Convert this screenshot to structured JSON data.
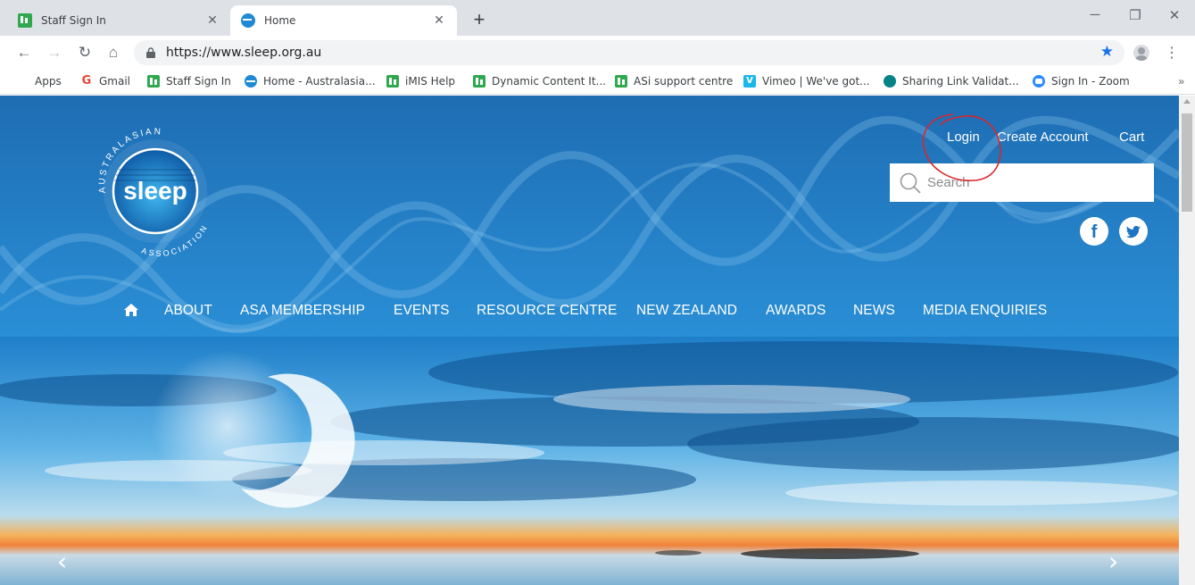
{
  "browser": {
    "tabs": [
      {
        "title": "Staff Sign In",
        "icon": "imis-icon",
        "active": false
      },
      {
        "title": "Home",
        "icon": "site-favicon",
        "active": true
      }
    ],
    "new_tab": "+",
    "url": "https://www.sleep.org.au",
    "bookmarks": [
      {
        "label": "Apps",
        "icon": "apps-grid-icon"
      },
      {
        "label": "Gmail",
        "icon": "gmail-icon"
      },
      {
        "label": "Staff Sign In",
        "icon": "imis-icon"
      },
      {
        "label": "Home - Australasia...",
        "icon": "globe-icon"
      },
      {
        "label": "iMIS Help",
        "icon": "imis-icon"
      },
      {
        "label": "Dynamic Content It...",
        "icon": "imis-icon"
      },
      {
        "label": "ASi support centre",
        "icon": "imis-icon"
      },
      {
        "label": "Vimeo | We've got...",
        "icon": "vimeo-icon"
      },
      {
        "label": "Sharing Link Validat...",
        "icon": "sharepoint-icon"
      },
      {
        "label": "Sign In - Zoom",
        "icon": "zoom-icon"
      }
    ],
    "bookmarks_overflow": "»"
  },
  "site": {
    "logo": {
      "top_text": "AUSTRALASIAN",
      "center_text": "sleep",
      "bottom_text": "ASSOCIATION"
    },
    "header_links": {
      "login": "Login",
      "create_account": "Create Account",
      "cart": "Cart"
    },
    "search": {
      "placeholder": "Search"
    },
    "social": [
      "facebook-icon",
      "twitter-icon"
    ],
    "nav": [
      "ABOUT",
      "ASA MEMBERSHIP",
      "EVENTS",
      "RESOURCE CENTRE",
      "NEW ZEALAND",
      "AWARDS",
      "NEWS",
      "MEDIA ENQUIRIES"
    ],
    "carousel": {
      "prev": "‹",
      "next": "›"
    }
  },
  "colors": {
    "header_blue": "#1e6db3",
    "header_blue_light": "#2a8fd6",
    "annotation_red": "#d9262c",
    "star_blue": "#1a73e8"
  }
}
